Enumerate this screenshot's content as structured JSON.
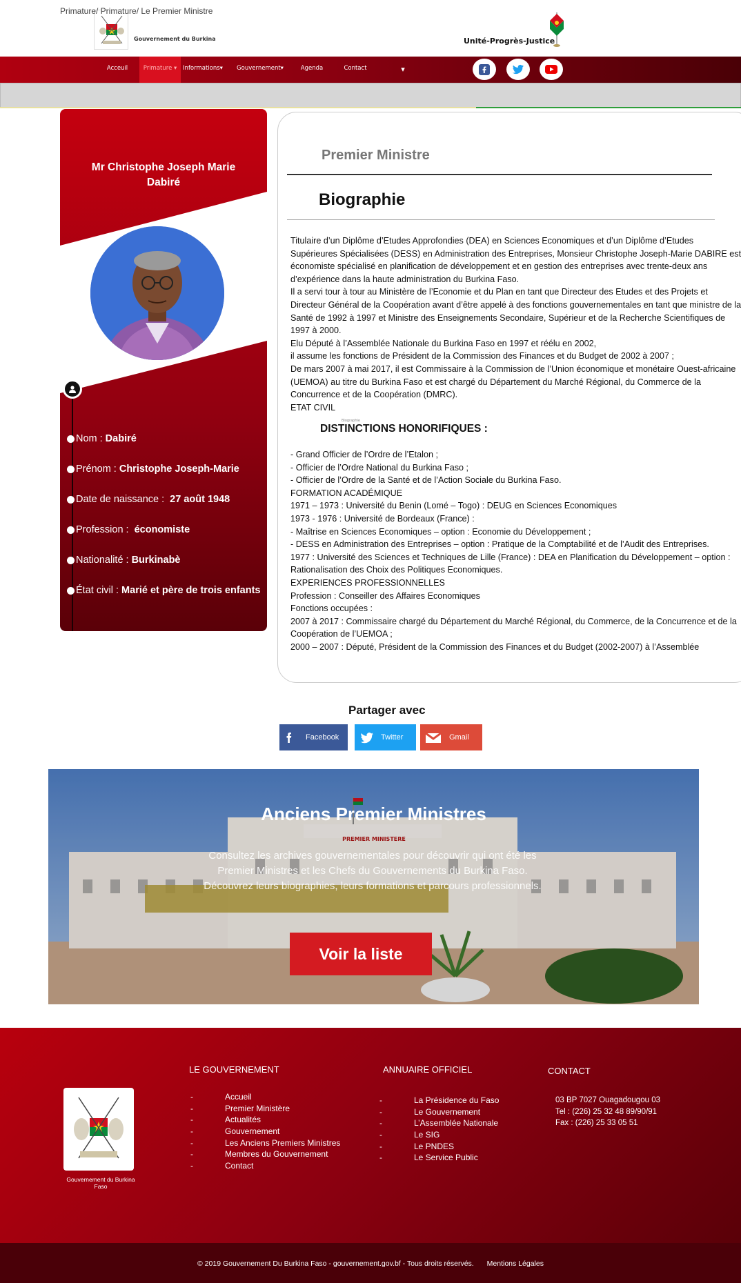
{
  "header": {
    "gov_name": "Gouvernement du Burkina",
    "motto": "Unité-Progrès-Justice"
  },
  "nav": {
    "items": [
      {
        "label": "Acceuil"
      },
      {
        "label": "Primature ▾"
      },
      {
        "label": "Informations▾"
      },
      {
        "label": "Gouvernement▾"
      },
      {
        "label": "Agenda"
      },
      {
        "label": "Contact"
      },
      {
        "label": "▾"
      }
    ],
    "social": [
      "facebook-icon",
      "twitter-icon",
      "youtube-icon"
    ]
  },
  "breadcrumb": "Primature/ Primature/ Le Premier Ministre",
  "profile": {
    "name": "Mr Christophe Joseph Marie Dabiré",
    "fields": [
      {
        "label": "Nom :",
        "value": "Dabiré"
      },
      {
        "label": "Prénom :",
        "value": "Christophe Joseph-Marie"
      },
      {
        "label": "Date de naissance :",
        "value": "27 août 1948"
      },
      {
        "label": "Profession :",
        "value": "économiste"
      },
      {
        "label": "Nationalité :",
        "value": "Burkinabè"
      },
      {
        "label": "État civil  :",
        "value": "Marié et père de trois enfants"
      }
    ]
  },
  "main": {
    "title": "Premier Ministre",
    "bio_title": "Biographie",
    "bio_para1": "Titulaire d’un Diplôme d’Etudes Approfondies (DEA) en Sciences Economiques et d’un Diplôme d’Etudes Supérieures Spécialisées (DESS) en Administration des Entreprises, Monsieur Christophe Joseph-Marie DABIRE est économiste spécialisé en planification de développement et en gestion des entreprises avec trente-deux ans d’expérience dans la haute administration du Burkina Faso.\nIl a servi tour à tour au Ministère de l’Economie et du Plan en tant que Directeur des Etudes et des Projets et Directeur Général de la Coopération avant d’être appelé à des fonctions gouvernementales en tant que ministre de la Santé de 1992 à 1997 et Ministre des Enseignements Secondaire, Supérieur et de la Recherche Scientifiques de 1997 à 2000.\nElu Député à l’Assemblée Nationale du Burkina Faso en 1997 et réélu en 2002,\nil assume les fonctions de Président de la Commission des Finances et du Budget de 2002 à 2007 ;\nDe mars 2007 à mai 2017, il est Commissaire à la Commission de l’Union économique et monétaire Ouest-africaine (UEMOA) au titre du Burkina Faso et est chargé du Département du Marché Régional, du Commerce de la Concurrence et de la Coopération (DMRC).\nETAT CIVIL",
    "tiny_label": "Biographie",
    "distinctions_title": "DISTINCTIONS HONORIFIQUES :",
    "bio_para2": "- Grand Officier de l’Ordre de l’Etalon ;\n- Officier de l’Ordre National du Burkina Faso ;\n- Officier de l’Ordre de la Santé et de l’Action Sociale du Burkina Faso.\nFORMATION ACADÉMIQUE\n1971 – 1973 : Université du Benin (Lomé – Togo) : DEUG en Sciences Economiques\n1973 - 1976 : Université de Bordeaux (France) :\n- Maîtrise en Sciences Economiques – option : Economie du Développement ;\n- DESS en Administration des Entreprises – option : Pratique de la Comptabilité et de l’Audit des Entreprises.\n1977 : Université des Sciences et Techniques de Lille (France) : DEA en Planification du Développement – option : Rationalisation des Choix des Politiques Economiques.\nEXPERIENCES PROFESSIONNELLES\nProfession : Conseiller des Affaires Economiques\nFonctions occupées :\n2007 à 2017 : Commissaire chargé du Département du Marché Régional, du Commerce, de la Concurrence et de la Coopération de l’UEMOA ;\n2000 – 2007 : Député, Président de la Commission des Finances et du Budget (2002-2007) à l’Assemblée"
  },
  "share": {
    "title": "Partager avec",
    "facebook": "Facebook",
    "twitter": "Twitter",
    "gmail": "Gmail"
  },
  "banner": {
    "title": "Anciens Premier Ministres",
    "text": "Consultez les archives gouvernementales pour découvrir qui ont été les Premier Ministres et les Chefs du Gouvernements du Burkina Faso. Découvrez leurs biographies, leurs formations et parcours professionnels.",
    "button": "Voir la liste",
    "building_sign": "PREMIER MINISTERE"
  },
  "footer": {
    "logo_caption": "Gouvernement du Burkina Faso",
    "col1_title": "LE GOUVERNEMENT",
    "col1_items": [
      "Accueil",
      "Premier Ministère",
      "Actualités",
      "Gouvernement",
      "Les Anciens Premiers Ministres",
      "Membres du Gouvernement",
      "Contact"
    ],
    "col2_title": "ANNUAIRE OFFICIEL",
    "col2_items": [
      "La Présidence du Faso",
      "Le Gouvernement",
      "L’Assemblée Nationale",
      "Le SIG",
      "Le PNDES",
      "Le Service Public"
    ],
    "col3_title": "CONTACT",
    "contact": [
      "03 BP 7027 Ouagadougou 03",
      "Tel : (226) 25 32 48 89/90/91",
      "Fax : (226) 25 33 05 51"
    ],
    "dash": "-",
    "copyright": "© 2019 Gouvernement Du Burkina Faso - gouvernement.gov.bf - Tous droits réservés.",
    "legal": "Mentions Légales"
  },
  "colors": {
    "brand_red": "#c4000f",
    "dark_red": "#5a0008",
    "facebook": "#3b5998",
    "twitter": "#1da1f2",
    "gmail": "#dd4b39"
  }
}
